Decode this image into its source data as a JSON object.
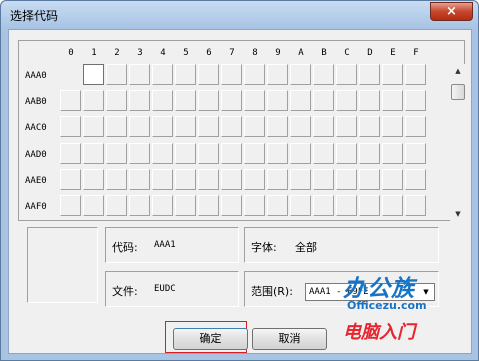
{
  "window": {
    "title": "选择代码",
    "close_label": "×"
  },
  "grid": {
    "columns": [
      "0",
      "1",
      "2",
      "3",
      "4",
      "5",
      "6",
      "7",
      "8",
      "9",
      "A",
      "B",
      "C",
      "D",
      "E",
      "F"
    ],
    "rows": [
      "AAA0",
      "AAB0",
      "AAC0",
      "AAD0",
      "AAE0",
      "AAF0"
    ],
    "scroll_up": "▲",
    "scroll_down": "▼"
  },
  "info": {
    "code_label": "代码:",
    "code_value": "AAA1",
    "font_label": "字体:",
    "font_value": "全部",
    "file_label": "文件:",
    "file_value": "EUDC",
    "range_label": "范围(R):",
    "range_value": "AAA1 - F9FE",
    "dropdown_arrow": "▼"
  },
  "buttons": {
    "ok": "确定",
    "cancel": "取消"
  },
  "watermark": {
    "line1": "办公族",
    "line2": "Officezu.com",
    "line3": "电脑入门",
    "colors": {
      "blue": "#1873c4",
      "red": "#e8242f"
    }
  }
}
